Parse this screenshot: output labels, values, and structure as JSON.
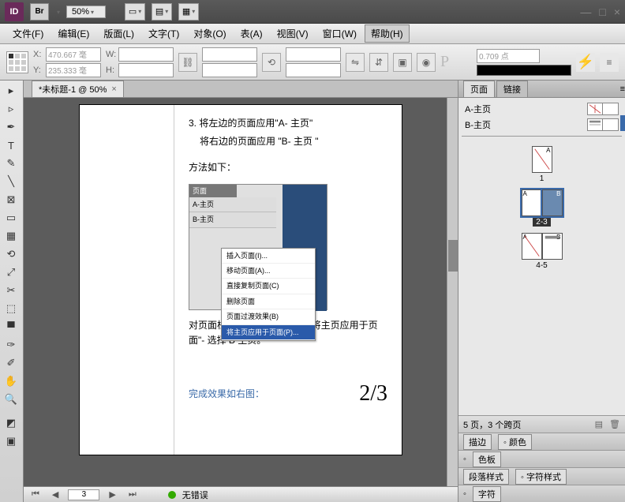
{
  "titlebar": {
    "zoom": "50%"
  },
  "menus": [
    "文件(F)",
    "编辑(E)",
    "版面(L)",
    "文字(T)",
    "对象(O)",
    "表(A)",
    "视图(V)",
    "窗口(W)",
    "帮助(H)"
  ],
  "active_menu_index": 8,
  "control": {
    "x_label": "X:",
    "x_value": "470.667 毫",
    "y_label": "Y:",
    "y_value": "235.333 毫",
    "w_label": "W:",
    "w_value": "",
    "h_label": "H:",
    "h_value": "",
    "stroke_weight": "0.709 点"
  },
  "doc_tab": {
    "title": "*未标题-1 @ 50%",
    "close": "×"
  },
  "document": {
    "item_num": "3.",
    "line1": "将左边的页面应用\"A- 主页\"",
    "line2": "将右边的页面应用 \"B- 主页 \"",
    "method": "方法如下：",
    "panel_hdr": "页面",
    "panel_a": "A-主页",
    "panel_b": "B-主页",
    "menu_items": [
      "插入页面(I)...",
      "移动页面(A)...",
      "直接复制页面(C)",
      "删除页面",
      "页面过渡效果(B)",
      "将主页应用于页面(P)..."
    ],
    "desc": "对页面栏下右边的页面右击 -\"将主页应用于页面\"- 选择 B 主页。",
    "result_text": "完成效果如右图：",
    "fraction": "2/3"
  },
  "status": {
    "page": "3",
    "errors": "无错误"
  },
  "panels": {
    "tab_pages": "页面",
    "tab_links": "链接",
    "master_a": "A-主页",
    "master_b": "B-主页",
    "thumb1": "1",
    "thumb23": "2-3",
    "thumb45": "4-5",
    "footer": "5 页，3 个跨页",
    "stroke": "描边",
    "color": "颜色",
    "swatches": "色板",
    "para_style": "段落样式",
    "char_style": "字符样式",
    "char": "字符"
  }
}
